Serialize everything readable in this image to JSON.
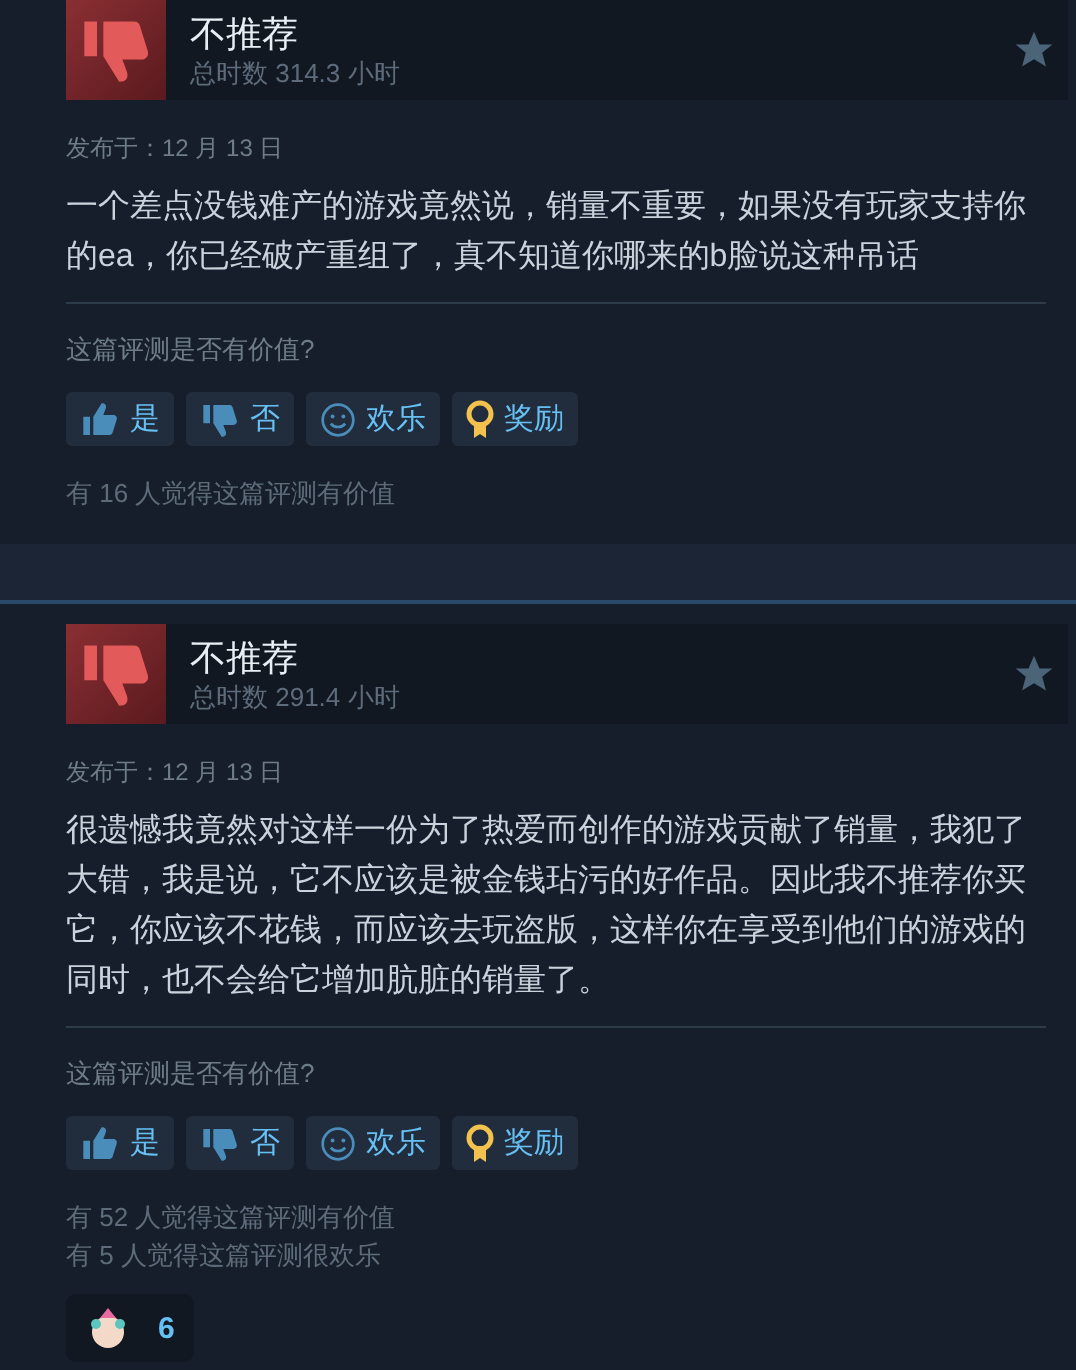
{
  "reviews": [
    {
      "verdict": "不推荐",
      "hours": "总时数 314.3 小时",
      "date": "发布于：12 月 13 日",
      "body": "一个差点没钱难产的游戏竟然说，销量不重要，如果没有玩家支持你的ea，你已经破产重组了，真不知道你哪来的b脸说这种吊话",
      "prompt": "这篇评测是否有价值?",
      "buttons": [
        {
          "kind": "yes",
          "label": "是"
        },
        {
          "kind": "no",
          "label": "否"
        },
        {
          "kind": "funny",
          "label": "欢乐"
        },
        {
          "kind": "award",
          "label": "奖励"
        }
      ],
      "counts": [
        "有 16 人觉得这篇评测有价值"
      ]
    },
    {
      "verdict": "不推荐",
      "hours": "总时数 291.4 小时",
      "date": "发布于：12 月 13 日",
      "body": "很遗憾我竟然对这样一份为了热爱而创作的游戏贡献了销量，我犯了大错，我是说，它不应该是被金钱玷污的好作品。因此我不推荐你买它，你应该不花钱，而应该去玩盗版，这样你在享受到他们的游戏的同时，也不会给它增加肮脏的销量了。",
      "prompt": "这篇评测是否有价值?",
      "buttons": [
        {
          "kind": "yes",
          "label": "是"
        },
        {
          "kind": "no",
          "label": "否"
        },
        {
          "kind": "funny",
          "label": "欢乐"
        },
        {
          "kind": "award",
          "label": "奖励"
        }
      ],
      "counts": [
        "有 52 人觉得这篇评测有价值",
        "有 5 人觉得这篇评测很欢乐"
      ],
      "awards": [
        {
          "count": "6"
        }
      ]
    }
  ]
}
